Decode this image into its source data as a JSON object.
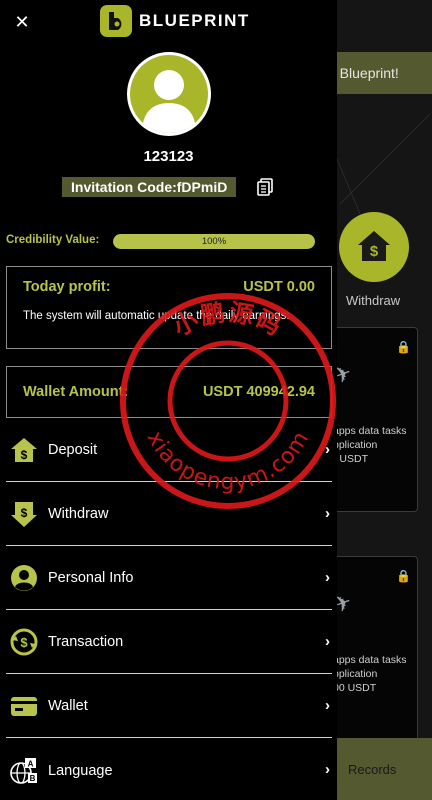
{
  "background": {
    "banner_text": "o Blueprint!",
    "withdraw_label": "Withdraw",
    "cards": [
      {
        "desc": "apps data tasks\npplication\n) USDT"
      },
      {
        "desc": "apps data tasks\npplication\n00 USDT"
      }
    ],
    "bottom_nav_records": "Records"
  },
  "header": {
    "brand": "BLUEPRINT",
    "brand_color": "#a9b62a"
  },
  "profile": {
    "username": "123123",
    "invitation_code": "Invitation Code:fDPmiD"
  },
  "credibility": {
    "label": "Credibility Value:",
    "percent_text": "100%",
    "fraction": 1.0
  },
  "today_profit": {
    "title": "Today profit:",
    "value": "USDT 0.00",
    "note": "The system will automatic update the daily earnings:"
  },
  "wallet": {
    "title": "Wallet Amount:",
    "value": "USDT 409942.94"
  },
  "menu": [
    {
      "label": "Deposit",
      "icon": "deposit-icon"
    },
    {
      "label": "Withdraw",
      "icon": "withdraw-icon"
    },
    {
      "label": "Personal Info",
      "icon": "user-icon"
    },
    {
      "label": "Transaction",
      "icon": "transaction-icon"
    },
    {
      "label": "Wallet",
      "icon": "wallet-icon"
    },
    {
      "label": "Language",
      "icon": "language-icon"
    }
  ],
  "watermark": {
    "top_text": "小鹏源码",
    "bottom_text": "xiaopengym.com",
    "color": "#e01818"
  },
  "colors": {
    "accent": "#a9b62a",
    "accent_text": "#b7c34a",
    "dark_olive": "#55592f"
  }
}
